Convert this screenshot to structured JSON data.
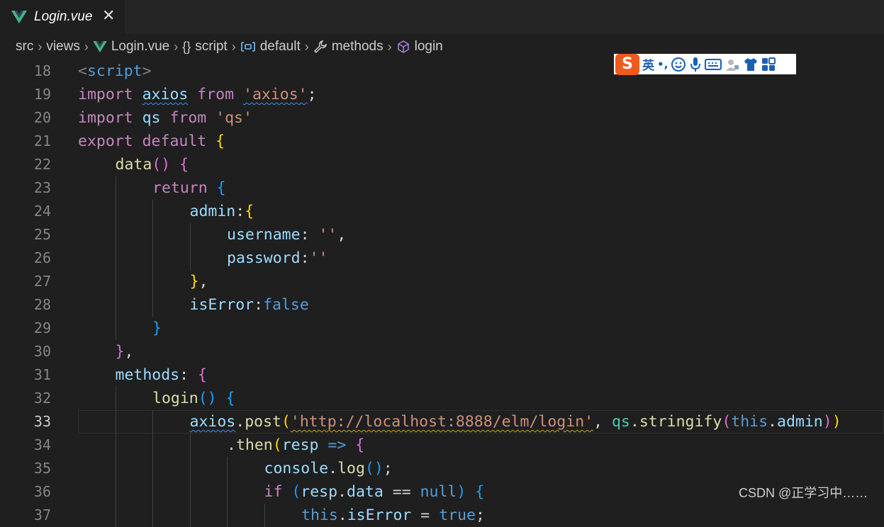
{
  "tab": {
    "filename": "Login.vue",
    "close_glyph": "✕",
    "icon": "vue-icon"
  },
  "breadcrumbs": [
    {
      "label": "src",
      "icon": ""
    },
    {
      "label": "views",
      "icon": ""
    },
    {
      "label": "Login.vue",
      "icon": "vue-icon"
    },
    {
      "label": "script",
      "icon": "braces-icon",
      "icon_text": "{}"
    },
    {
      "label": "default",
      "icon": "module-icon"
    },
    {
      "label": "methods",
      "icon": "wrench-icon"
    },
    {
      "label": "login",
      "icon": "cube-icon"
    }
  ],
  "editor": {
    "current_line": 33,
    "lines": [
      {
        "n": 18,
        "indent": 0,
        "tokens": [
          [
            "t-tag",
            "<"
          ],
          [
            "t-tagname",
            "script"
          ],
          [
            "t-tag",
            ">"
          ]
        ]
      },
      {
        "n": 19,
        "indent": 0,
        "tokens": [
          [
            "t-kw",
            "import "
          ],
          [
            "t-var sq",
            "axios"
          ],
          [
            "t-kw",
            " from "
          ],
          [
            "t-str sq",
            "'axios'"
          ],
          [
            "t-op",
            ";"
          ]
        ]
      },
      {
        "n": 20,
        "indent": 0,
        "tokens": [
          [
            "t-kw",
            "import "
          ],
          [
            "t-var",
            "qs"
          ],
          [
            "t-kw",
            " from "
          ],
          [
            "t-str",
            "'qs'"
          ]
        ]
      },
      {
        "n": 21,
        "indent": 0,
        "tokens": [
          [
            "t-kw",
            "export default "
          ],
          [
            "t-b1",
            "{"
          ]
        ]
      },
      {
        "n": 22,
        "indent": 1,
        "tokens": [
          [
            "t-fn",
            "data"
          ],
          [
            "t-b2",
            "()"
          ],
          [
            "t-op",
            " "
          ],
          [
            "t-b2",
            "{"
          ]
        ]
      },
      {
        "n": 23,
        "indent": 2,
        "tokens": [
          [
            "t-kw",
            "return "
          ],
          [
            "t-b3",
            "{"
          ]
        ]
      },
      {
        "n": 24,
        "indent": 3,
        "tokens": [
          [
            "t-var",
            "admin"
          ],
          [
            "t-op",
            ":"
          ],
          [
            "t-b1",
            "{"
          ]
        ]
      },
      {
        "n": 25,
        "indent": 4,
        "tokens": [
          [
            "t-var",
            "username"
          ],
          [
            "t-op",
            ": "
          ],
          [
            "t-str",
            "''"
          ],
          [
            "t-op",
            ","
          ]
        ]
      },
      {
        "n": 26,
        "indent": 4,
        "tokens": [
          [
            "t-var",
            "password"
          ],
          [
            "t-op",
            ":"
          ],
          [
            "t-str",
            "''"
          ]
        ]
      },
      {
        "n": 27,
        "indent": 3,
        "tokens": [
          [
            "t-b1",
            "}"
          ],
          [
            "t-op",
            ","
          ]
        ]
      },
      {
        "n": 28,
        "indent": 3,
        "tokens": [
          [
            "t-var",
            "isError"
          ],
          [
            "t-op",
            ":"
          ],
          [
            "t-bl",
            "false"
          ]
        ]
      },
      {
        "n": 29,
        "indent": 2,
        "tokens": [
          [
            "t-b3",
            "}"
          ]
        ]
      },
      {
        "n": 30,
        "indent": 1,
        "tokens": [
          [
            "t-b2",
            "}"
          ],
          [
            "t-op",
            ","
          ]
        ]
      },
      {
        "n": 31,
        "indent": 1,
        "tokens": [
          [
            "t-var",
            "methods"
          ],
          [
            "t-op",
            ": "
          ],
          [
            "t-b2",
            "{"
          ]
        ]
      },
      {
        "n": 32,
        "indent": 2,
        "tokens": [
          [
            "t-fn",
            "login"
          ],
          [
            "t-b3",
            "()"
          ],
          [
            "t-op",
            " "
          ],
          [
            "t-b3",
            "{"
          ]
        ]
      },
      {
        "n": 33,
        "indent": 3,
        "tokens": [
          [
            "t-var sq",
            "axios"
          ],
          [
            "t-op",
            "."
          ],
          [
            "t-fn",
            "post"
          ],
          [
            "t-b1",
            "("
          ],
          [
            "t-str sqo",
            "'http://localhost:8888/elm/login'"
          ],
          [
            "t-op",
            ", "
          ],
          [
            "t-cls",
            "qs"
          ],
          [
            "t-op",
            "."
          ],
          [
            "t-fn",
            "stringify"
          ],
          [
            "t-b2",
            "("
          ],
          [
            "t-bl",
            "this"
          ],
          [
            "t-op",
            "."
          ],
          [
            "t-var",
            "admin"
          ],
          [
            "t-b2",
            ")"
          ],
          [
            "t-b1",
            ")"
          ]
        ]
      },
      {
        "n": 34,
        "indent": 4,
        "tokens": [
          [
            "t-op",
            "."
          ],
          [
            "t-fn",
            "then"
          ],
          [
            "t-b1",
            "("
          ],
          [
            "t-var",
            "resp"
          ],
          [
            "t-op",
            " "
          ],
          [
            "t-bl",
            "=>"
          ],
          [
            "t-op",
            " "
          ],
          [
            "t-b2",
            "{"
          ]
        ]
      },
      {
        "n": 35,
        "indent": 5,
        "tokens": [
          [
            "t-var",
            "console"
          ],
          [
            "t-op",
            "."
          ],
          [
            "t-fn",
            "log"
          ],
          [
            "t-b3",
            "()"
          ],
          [
            "t-op",
            ";"
          ]
        ]
      },
      {
        "n": 36,
        "indent": 5,
        "tokens": [
          [
            "t-kw",
            "if "
          ],
          [
            "t-b3",
            "("
          ],
          [
            "t-var",
            "resp"
          ],
          [
            "t-op",
            "."
          ],
          [
            "t-var",
            "data"
          ],
          [
            "t-op",
            " == "
          ],
          [
            "t-bl",
            "null"
          ],
          [
            "t-b3",
            ")"
          ],
          [
            "t-op",
            " "
          ],
          [
            "t-b3",
            "{"
          ]
        ]
      },
      {
        "n": 37,
        "indent": 6,
        "tokens": [
          [
            "t-bl",
            "this"
          ],
          [
            "t-op",
            "."
          ],
          [
            "t-var",
            "isError"
          ],
          [
            "t-op",
            " = "
          ],
          [
            "t-bl",
            "true"
          ],
          [
            "t-op",
            ";"
          ]
        ]
      }
    ]
  },
  "ime_toolbar": {
    "logo": "S",
    "mode_label": "英",
    "punct_label": "•,",
    "icons": [
      "smiley-icon",
      "microphone-icon",
      "keyboard-icon",
      "user-icon",
      "shirt-icon",
      "grid-icon"
    ]
  },
  "watermark": "CSDN @正学习中……",
  "colors": {
    "background": "#1f1f1f",
    "keyword": "#c586c0",
    "string": "#ce9178",
    "variable": "#9cdcfe",
    "function": "#dcdcaa"
  }
}
